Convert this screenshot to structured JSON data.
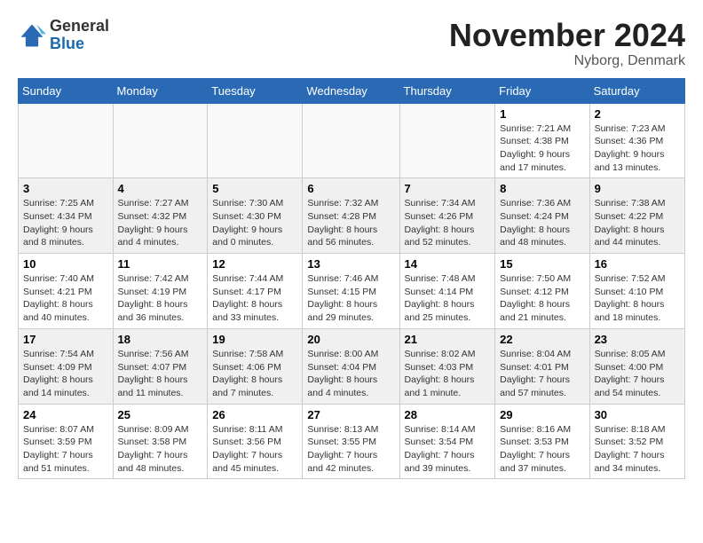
{
  "header": {
    "logo_line1": "General",
    "logo_line2": "Blue",
    "month_title": "November 2024",
    "location": "Nyborg, Denmark"
  },
  "weekdays": [
    "Sunday",
    "Monday",
    "Tuesday",
    "Wednesday",
    "Thursday",
    "Friday",
    "Saturday"
  ],
  "weeks": [
    [
      {
        "day": "",
        "info": ""
      },
      {
        "day": "",
        "info": ""
      },
      {
        "day": "",
        "info": ""
      },
      {
        "day": "",
        "info": ""
      },
      {
        "day": "",
        "info": ""
      },
      {
        "day": "1",
        "info": "Sunrise: 7:21 AM\nSunset: 4:38 PM\nDaylight: 9 hours\nand 17 minutes."
      },
      {
        "day": "2",
        "info": "Sunrise: 7:23 AM\nSunset: 4:36 PM\nDaylight: 9 hours\nand 13 minutes."
      }
    ],
    [
      {
        "day": "3",
        "info": "Sunrise: 7:25 AM\nSunset: 4:34 PM\nDaylight: 9 hours\nand 8 minutes."
      },
      {
        "day": "4",
        "info": "Sunrise: 7:27 AM\nSunset: 4:32 PM\nDaylight: 9 hours\nand 4 minutes."
      },
      {
        "day": "5",
        "info": "Sunrise: 7:30 AM\nSunset: 4:30 PM\nDaylight: 9 hours\nand 0 minutes."
      },
      {
        "day": "6",
        "info": "Sunrise: 7:32 AM\nSunset: 4:28 PM\nDaylight: 8 hours\nand 56 minutes."
      },
      {
        "day": "7",
        "info": "Sunrise: 7:34 AM\nSunset: 4:26 PM\nDaylight: 8 hours\nand 52 minutes."
      },
      {
        "day": "8",
        "info": "Sunrise: 7:36 AM\nSunset: 4:24 PM\nDaylight: 8 hours\nand 48 minutes."
      },
      {
        "day": "9",
        "info": "Sunrise: 7:38 AM\nSunset: 4:22 PM\nDaylight: 8 hours\nand 44 minutes."
      }
    ],
    [
      {
        "day": "10",
        "info": "Sunrise: 7:40 AM\nSunset: 4:21 PM\nDaylight: 8 hours\nand 40 minutes."
      },
      {
        "day": "11",
        "info": "Sunrise: 7:42 AM\nSunset: 4:19 PM\nDaylight: 8 hours\nand 36 minutes."
      },
      {
        "day": "12",
        "info": "Sunrise: 7:44 AM\nSunset: 4:17 PM\nDaylight: 8 hours\nand 33 minutes."
      },
      {
        "day": "13",
        "info": "Sunrise: 7:46 AM\nSunset: 4:15 PM\nDaylight: 8 hours\nand 29 minutes."
      },
      {
        "day": "14",
        "info": "Sunrise: 7:48 AM\nSunset: 4:14 PM\nDaylight: 8 hours\nand 25 minutes."
      },
      {
        "day": "15",
        "info": "Sunrise: 7:50 AM\nSunset: 4:12 PM\nDaylight: 8 hours\nand 21 minutes."
      },
      {
        "day": "16",
        "info": "Sunrise: 7:52 AM\nSunset: 4:10 PM\nDaylight: 8 hours\nand 18 minutes."
      }
    ],
    [
      {
        "day": "17",
        "info": "Sunrise: 7:54 AM\nSunset: 4:09 PM\nDaylight: 8 hours\nand 14 minutes."
      },
      {
        "day": "18",
        "info": "Sunrise: 7:56 AM\nSunset: 4:07 PM\nDaylight: 8 hours\nand 11 minutes."
      },
      {
        "day": "19",
        "info": "Sunrise: 7:58 AM\nSunset: 4:06 PM\nDaylight: 8 hours\nand 7 minutes."
      },
      {
        "day": "20",
        "info": "Sunrise: 8:00 AM\nSunset: 4:04 PM\nDaylight: 8 hours\nand 4 minutes."
      },
      {
        "day": "21",
        "info": "Sunrise: 8:02 AM\nSunset: 4:03 PM\nDaylight: 8 hours\nand 1 minute."
      },
      {
        "day": "22",
        "info": "Sunrise: 8:04 AM\nSunset: 4:01 PM\nDaylight: 7 hours\nand 57 minutes."
      },
      {
        "day": "23",
        "info": "Sunrise: 8:05 AM\nSunset: 4:00 PM\nDaylight: 7 hours\nand 54 minutes."
      }
    ],
    [
      {
        "day": "24",
        "info": "Sunrise: 8:07 AM\nSunset: 3:59 PM\nDaylight: 7 hours\nand 51 minutes."
      },
      {
        "day": "25",
        "info": "Sunrise: 8:09 AM\nSunset: 3:58 PM\nDaylight: 7 hours\nand 48 minutes."
      },
      {
        "day": "26",
        "info": "Sunrise: 8:11 AM\nSunset: 3:56 PM\nDaylight: 7 hours\nand 45 minutes."
      },
      {
        "day": "27",
        "info": "Sunrise: 8:13 AM\nSunset: 3:55 PM\nDaylight: 7 hours\nand 42 minutes."
      },
      {
        "day": "28",
        "info": "Sunrise: 8:14 AM\nSunset: 3:54 PM\nDaylight: 7 hours\nand 39 minutes."
      },
      {
        "day": "29",
        "info": "Sunrise: 8:16 AM\nSunset: 3:53 PM\nDaylight: 7 hours\nand 37 minutes."
      },
      {
        "day": "30",
        "info": "Sunrise: 8:18 AM\nSunset: 3:52 PM\nDaylight: 7 hours\nand 34 minutes."
      }
    ]
  ]
}
